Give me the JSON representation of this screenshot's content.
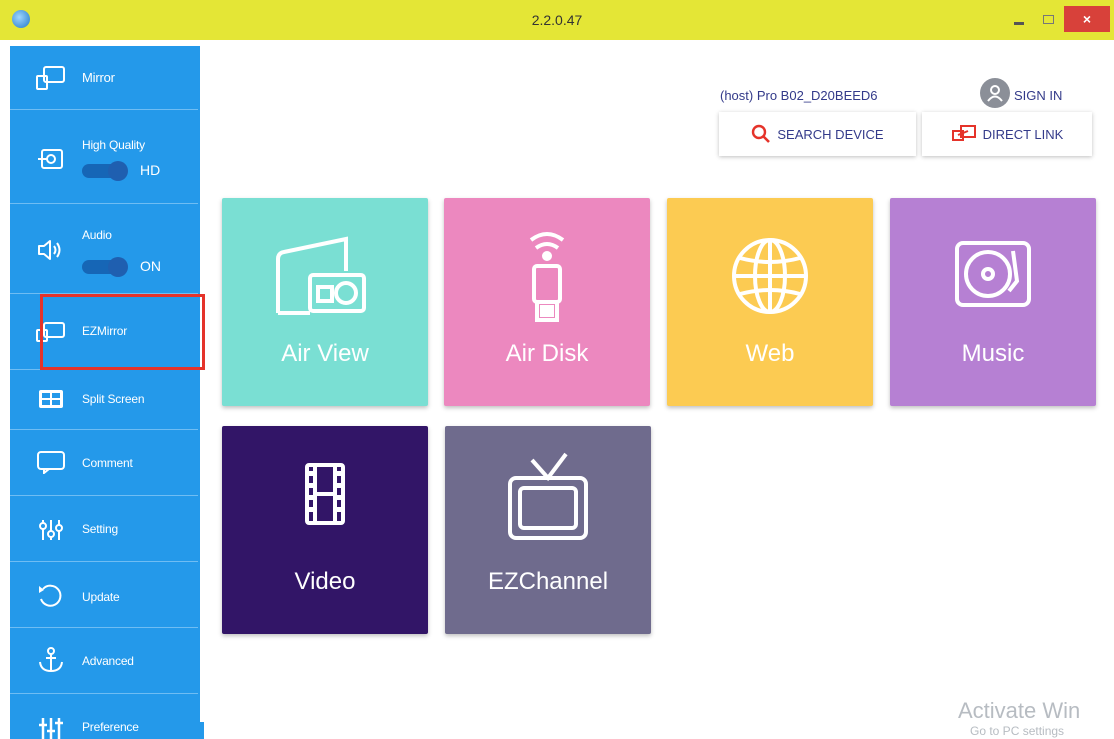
{
  "window": {
    "title": "2.2.0.47",
    "minimize_label": "",
    "maximize_label": "",
    "close_label": "×"
  },
  "sidebar": {
    "items": [
      {
        "label": "Mirror",
        "icon": "mirror-icon"
      },
      {
        "label": "High Quality",
        "icon": "high-quality-icon",
        "toggle_state": "HD"
      },
      {
        "label": "Audio",
        "icon": "speaker-icon",
        "toggle_state": "ON"
      },
      {
        "label": "EZMirror",
        "icon": "ezmirror-icon"
      },
      {
        "label": "Split Screen",
        "icon": "split-screen-icon"
      },
      {
        "label": "Comment",
        "icon": "comment-icon"
      },
      {
        "label": "Setting",
        "icon": "sliders-icon"
      },
      {
        "label": "Update",
        "icon": "update-icon"
      },
      {
        "label": "Advanced",
        "icon": "anchor-icon"
      },
      {
        "label": "Preference",
        "icon": "preference-icon"
      }
    ],
    "accent": "#2499ea",
    "highlight_color": "#e5332a"
  },
  "header": {
    "host": "(host) Pro B02_D20BEED6",
    "sign_in": "SIGN IN",
    "search_device": "SEARCH DEVICE",
    "direct_link": "DIRECT LINK"
  },
  "tiles": [
    {
      "label": "Air View",
      "color": "#7adfd3",
      "icon": "air-view-icon"
    },
    {
      "label": "Air Disk",
      "color": "#ec88bf",
      "icon": "usb-wifi-icon"
    },
    {
      "label": "Web",
      "color": "#fccb52",
      "icon": "globe-icon"
    },
    {
      "label": "Music",
      "color": "#b680d3",
      "icon": "turntable-icon"
    },
    {
      "label": "Video",
      "color": "#321567",
      "icon": "film-icon"
    },
    {
      "label": "EZChannel",
      "color": "#6f6b8d",
      "icon": "tv-icon"
    }
  ],
  "watermark": {
    "line1": "Acti​vate Win",
    "line2": "Go to PC settings"
  }
}
